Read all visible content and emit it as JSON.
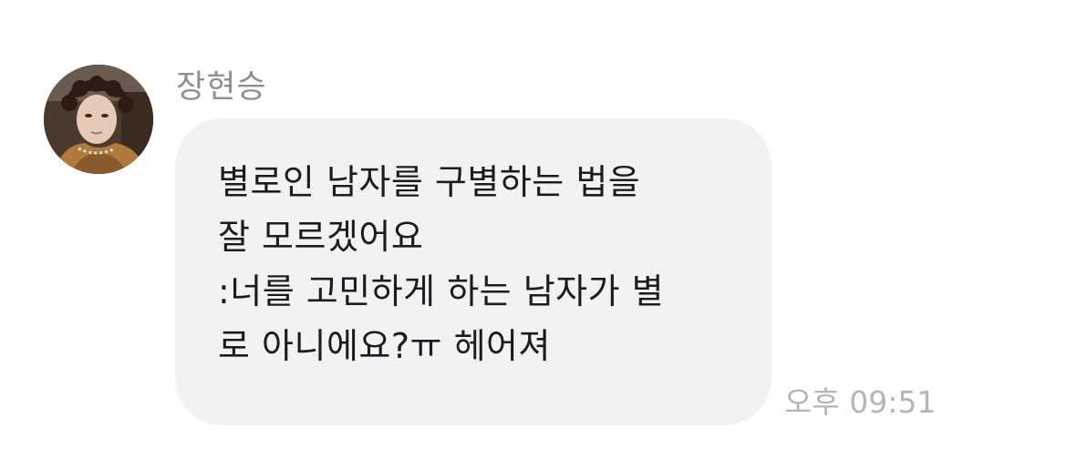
{
  "message": {
    "sender": "장현승",
    "avatar_icon": "profile-photo",
    "lines": [
      "별로인 남자를 구별하는 법을",
      "잘 모르겠어요",
      ":너를 고민하게 하는 남자가 별",
      "로 아니에요?ㅠ 헤어져"
    ],
    "time": "오후 09:51"
  },
  "colors": {
    "bubble": "#f2f2f5",
    "text": "#1c1c1e",
    "sender": "#8e8e93",
    "time": "#b4b4b9"
  }
}
